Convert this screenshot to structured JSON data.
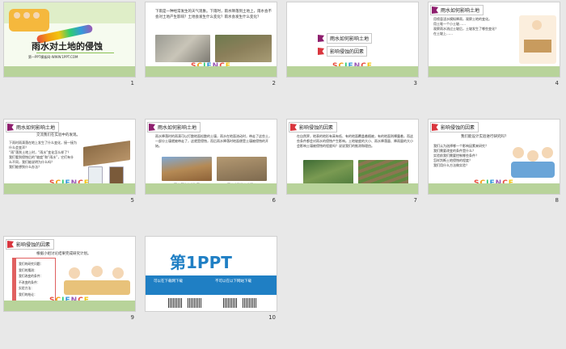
{
  "slides": [
    {
      "num": "1",
      "title": "雨水对土地的侵蚀",
      "subtitle": "第一PPT模板网-WWW.1PPT.COM"
    },
    {
      "num": "2",
      "text": "下雨是一种经常发生的天气现象。下雨时，雨水降落到土地上，雨水会不会对土地产生影响？土地会发生什么变化？雨水会发生什么变化？",
      "science": "SCIENCE"
    },
    {
      "num": "3",
      "items": [
        "雨水如何影响土地",
        "影响侵蚀的因素"
      ],
      "science": "SCIENCE"
    },
    {
      "num": "4",
      "header": "雨水如何影响土地",
      "bullets": [
        "用喷壶浇水模拟降雨，观察土地的变化。",
        "用土堆一个小土坡……",
        "观察雨水流过土坡后，土坡发生了哪些变化？",
        "在土坡上……"
      ]
    },
    {
      "num": "5",
      "header": "雨水如何影响土地",
      "lead": "交流我们在实验中的发现。",
      "bullets": [
        "下雨时雨滴落在地上发生了什么变化，接一接为什么会变浑？",
        "“雨”落到土地上时，“雨水”变化怎么样了？",
        "我们看到侵蚀后的“坡度”和“雨水”，它们有什么不同，我们能说明为什么吗？",
        "我们能想到什么办法？"
      ],
      "science": "SCIENCE"
    },
    {
      "num": "6",
      "header": "雨水如何影响土地",
      "text": "雨水降落时的雨滴可以打散地面松散的土壤，雨水在地面流动时，带走了这些土，一部分土壤就被带走了，这就是侵蚀，而后雨水降落时地面便是土壤被侵蚀的开始。",
      "highlight": "侵蚀",
      "captions": [
        "雨水侵蚀出的沟渠",
        "雨水冲刷带走的泥沙"
      ]
    },
    {
      "num": "7",
      "header": "影响侵蚀的因素",
      "text": "在自然界，地表的地形有高有低、有的地面覆盖着植被，有的地面则裸露着，而这些条件都会对雨水的侵蚀产生影响。土地坡度的大小、雨水降落量、降雨量的大小会影响土壤被侵蚀的程度吗？说说我们的推测和理由。"
    },
    {
      "num": "8",
      "header": "影响侵蚀的因素",
      "lead": "我们能设计实验进行研究吗？",
      "bullets": [
        "我们认为选择哪一个影响因素来研究？",
        "我们需要改变的条件是什么？",
        "实验前我们需要控制哪些条件？",
        "怎样判断土地侵蚀的程度？",
        "我们用什么方法做实验？"
      ],
      "science": "SCIENCE"
    },
    {
      "num": "9",
      "header": "影响侵蚀的因素",
      "lead": "根据小组讨论结果完成研究计划。",
      "plan": [
        "我们的研究问题：",
        "我们的猜测：",
        "我们改变的条件：",
        "不改变的条件：",
        "实验方法：",
        "我们的结论："
      ],
      "science": "SCIENCE"
    },
    {
      "num": "10",
      "logo": "第1PPT",
      "ad1": "可以在下载网下载",
      "ad2": "不可以在以下网站下载"
    }
  ]
}
